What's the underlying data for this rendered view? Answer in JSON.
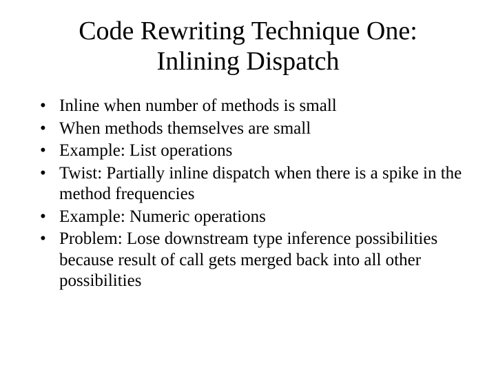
{
  "title_line1": "Code Rewriting Technique One:",
  "title_line2": "Inlining Dispatch",
  "bullets": [
    "Inline when number of methods is small",
    "When methods themselves are small",
    "Example: List operations",
    "Twist: Partially inline dispatch when there is a spike in the method frequencies",
    "Example: Numeric operations",
    "Problem: Lose downstream type inference possibilities because result of call gets merged back into all other possibilities"
  ]
}
